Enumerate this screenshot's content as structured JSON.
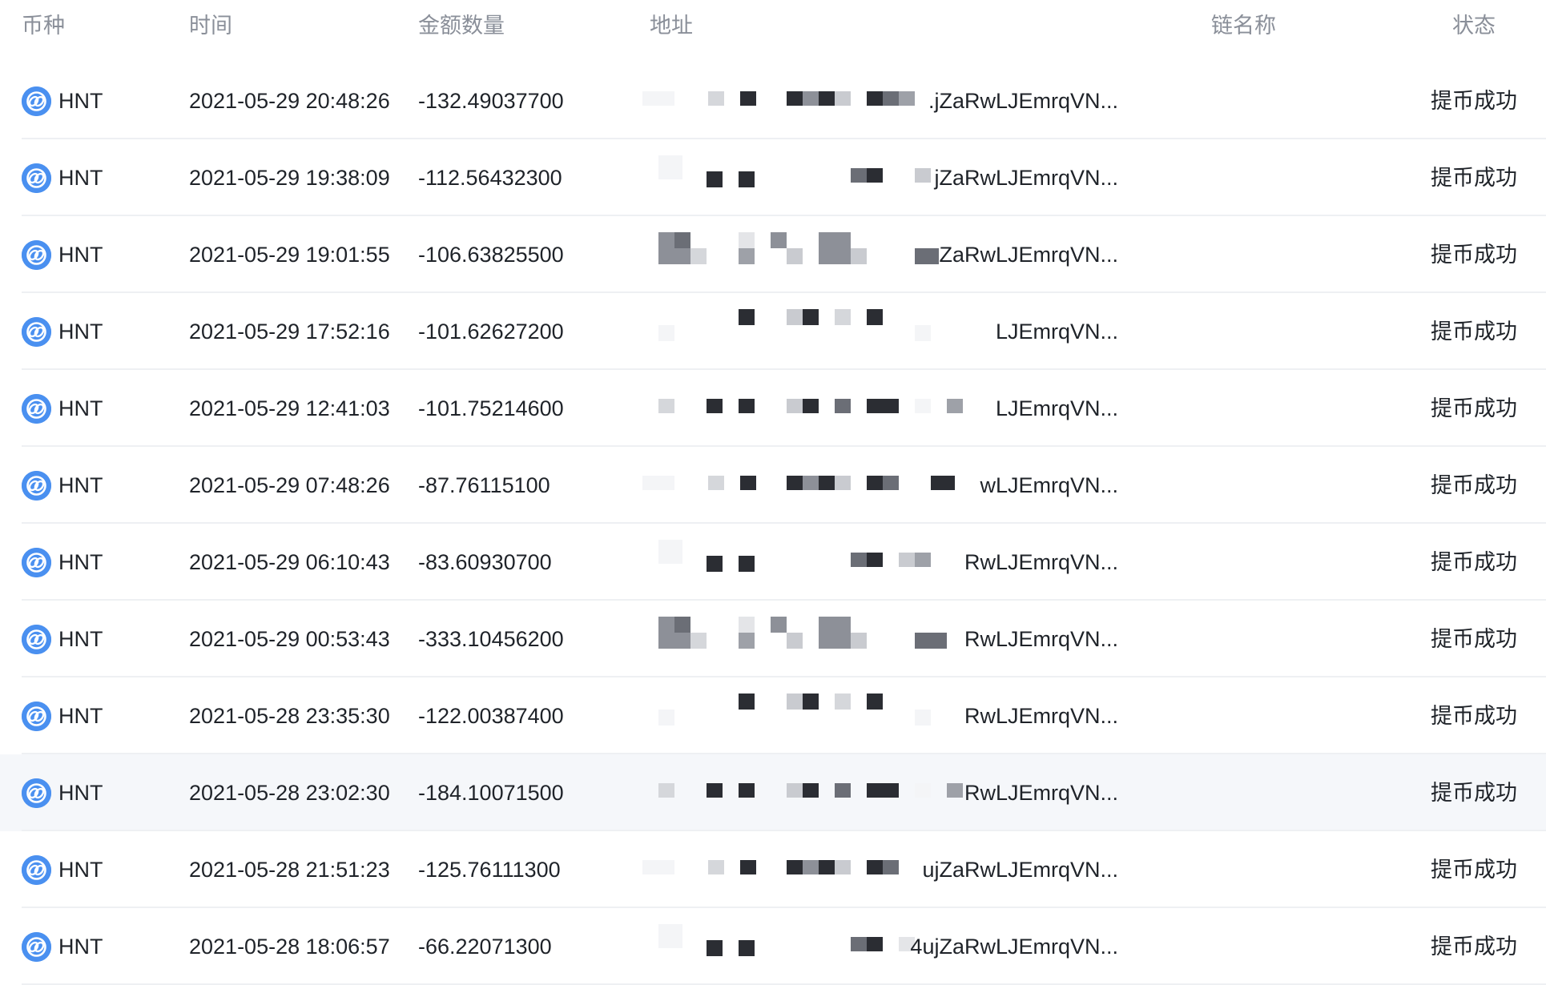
{
  "columns": {
    "coin": "币种",
    "time": "时间",
    "amount": "金额数量",
    "address": "地址",
    "chain": "链名称",
    "status": "状态"
  },
  "colors": {
    "icon": "#4a90f0",
    "header_text": "#8a8f99",
    "row_hover": "#f5f7fa"
  },
  "rows": [
    {
      "coin": "HNT",
      "time": "2021-05-29 20:48:26",
      "amount": "-132.49037700",
      "address_visible": ".jZaRwLJEmrqVN...",
      "chain": "",
      "status": "提币成功"
    },
    {
      "coin": "HNT",
      "time": "2021-05-29 19:38:09",
      "amount": "-112.56432300",
      "address_visible": "jZaRwLJEmrqVN...",
      "chain": "",
      "status": "提币成功"
    },
    {
      "coin": "HNT",
      "time": "2021-05-29 19:01:55",
      "amount": "-106.63825500",
      "address_visible": "ZaRwLJEmrqVN...",
      "chain": "",
      "status": "提币成功"
    },
    {
      "coin": "HNT",
      "time": "2021-05-29 17:52:16",
      "amount": "-101.62627200",
      "address_visible": "LJEmrqVN...",
      "chain": "",
      "status": "提币成功"
    },
    {
      "coin": "HNT",
      "time": "2021-05-29 12:41:03",
      "amount": "-101.75214600",
      "address_visible": "LJEmrqVN...",
      "chain": "",
      "status": "提币成功"
    },
    {
      "coin": "HNT",
      "time": "2021-05-29 07:48:26",
      "amount": "-87.76115100",
      "address_visible": "wLJEmrqVN...",
      "chain": "",
      "status": "提币成功"
    },
    {
      "coin": "HNT",
      "time": "2021-05-29 06:10:43",
      "amount": "-83.60930700",
      "address_visible": "RwLJEmrqVN...",
      "chain": "",
      "status": "提币成功"
    },
    {
      "coin": "HNT",
      "time": "2021-05-29 00:53:43",
      "amount": "-333.10456200",
      "address_visible": "RwLJEmrqVN...",
      "chain": "",
      "status": "提币成功"
    },
    {
      "coin": "HNT",
      "time": "2021-05-28 23:35:30",
      "amount": "-122.00387400",
      "address_visible": "RwLJEmrqVN...",
      "chain": "",
      "status": "提币成功"
    },
    {
      "coin": "HNT",
      "time": "2021-05-28 23:02:30",
      "amount": "-184.10071500",
      "address_visible": "RwLJEmrqVN...",
      "chain": "",
      "status": "提币成功"
    },
    {
      "coin": "HNT",
      "time": "2021-05-28 21:51:23",
      "amount": "-125.76111300",
      "address_visible": "ujZaRwLJEmrqVN...",
      "chain": "",
      "status": "提币成功"
    },
    {
      "coin": "HNT",
      "time": "2021-05-28 18:06:57",
      "amount": "-66.22071300",
      "address_visible": "4ujZaRwLJEmrqVN...",
      "chain": "",
      "status": "提币成功"
    }
  ]
}
